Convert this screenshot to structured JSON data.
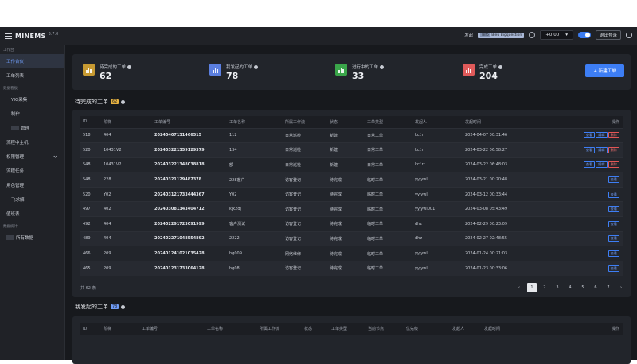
{
  "app": {
    "title": "MINEMS",
    "version": "3.7.0"
  },
  "topbar": {
    "label": "发起",
    "badge_prefix": "Info",
    "badge_text": "Bleu Bigquestion",
    "time_value": "+0:00",
    "time_unit": "▾",
    "logout_label": "退出登录"
  },
  "sidebar": {
    "groups": [
      {
        "label": "工作台",
        "items": [
          {
            "label": "工作台仪",
            "active": true
          },
          {
            "label": "工单列表",
            "active": false
          }
        ]
      },
      {
        "label": "数据看板",
        "items": [
          {
            "label": "YIG采集",
            "sub": true
          },
          {
            "label": "制作",
            "sub": true
          },
          {
            "label": "管理",
            "sub": true,
            "blur": true
          },
          {
            "label": "流程中主机"
          },
          {
            "label": "权限管理",
            "chevron": true
          },
          {
            "label": "流程任务"
          },
          {
            "label": "角色管理"
          },
          {
            "label": "飞求解",
            "sub": true
          },
          {
            "label": "值班表"
          }
        ]
      },
      {
        "label": "数据统计",
        "items": [
          {
            "label": "所有数据",
            "blur": true
          }
        ]
      }
    ]
  },
  "stats": [
    {
      "label": "待完成的工单",
      "value": "62",
      "color": "#c79a32",
      "icon": "chart-bar-icon"
    },
    {
      "label": "我发起的工单",
      "value": "78",
      "color": "#5b7fe0",
      "icon": "chart-bar-icon"
    },
    {
      "label": "进行中的工单",
      "value": "33",
      "color": "#3aa64a",
      "icon": "chart-bar-icon"
    },
    {
      "label": "完成工单",
      "value": "204",
      "color": "#e05a5a",
      "icon": "chart-bar-icon"
    }
  ],
  "new_button": "+ 新建工单",
  "pending": {
    "title": "待完成的工单",
    "count": "62",
    "count_color": "#e8b341",
    "columns": [
      "ID",
      "阶梯",
      "工单编号",
      "工单名称",
      "所属工作流",
      "状态",
      "工单类型",
      "发起人",
      "发起时间",
      "操作"
    ],
    "rows": [
      {
        "id": "518",
        "step": "404",
        "no": "20240407131466515",
        "name": "112",
        "flow": "日常巡检",
        "status": "新建",
        "type": "日常工单",
        "by": "kcf.rr",
        "time": "2024-04-07 00:31:46",
        "ops": [
          "查看",
          "编辑",
          "删除"
        ]
      },
      {
        "id": "520",
        "step": "10431V2",
        "no": "20240322135912937​9",
        "name": "134",
        "flow": "日常巡检",
        "status": "新建",
        "type": "日常工单",
        "by": "kcf.rr",
        "time": "2024-03-22 06:58:27",
        "ops": [
          "查看",
          "编辑",
          "删除"
        ]
      },
      {
        "id": "548",
        "step": "10431V2",
        "no": "20240322134803881​8",
        "name": "额",
        "flow": "日常巡检",
        "status": "新建",
        "type": "日常工单",
        "by": "kcf.rr",
        "time": "2024-03-22 06:48:03",
        "ops": [
          "查看",
          "编辑",
          "删除"
        ]
      },
      {
        "id": "548",
        "step": "228",
        "no": "20240321129487378",
        "name": "228客户",
        "flow": "访客登记",
        "status": "待完成",
        "type": "临时工单",
        "by": "yyjywl",
        "time": "2024-03-21 00:20:48",
        "ops": [
          "查看"
        ]
      },
      {
        "id": "520",
        "step": "Y02",
        "no": "20240312173344436​7",
        "name": "Y02",
        "flow": "访客登记",
        "status": "待完成",
        "type": "临时工单",
        "by": "yyjywl",
        "time": "2024-03-12 00:33:44",
        "ops": [
          "查看"
        ]
      },
      {
        "id": "497",
        "step": "402",
        "no": "20240308134340471​2",
        "name": "kjk2dj",
        "flow": "访客登记",
        "status": "待完成",
        "type": "临时工单",
        "by": "yyjywl001",
        "time": "2024-03-08 05:43:49",
        "ops": [
          "查看"
        ]
      },
      {
        "id": "492",
        "step": "404",
        "no": "20240229172309199​9",
        "name": "客户测试",
        "flow": "访客登记",
        "status": "待完成",
        "type": "临时工单",
        "by": "dhz",
        "time": "2024-02-29 00:23:09",
        "ops": [
          "查看"
        ]
      },
      {
        "id": "489",
        "step": "404",
        "no": "20240227104855489​2",
        "name": "2222",
        "flow": "访客登记",
        "status": "待完成",
        "type": "临时工单",
        "by": "dhz",
        "time": "2024-02-27 02:48:55",
        "ops": [
          "查看"
        ]
      },
      {
        "id": "466",
        "step": "209",
        "no": "20240124102103542​8",
        "name": "hg009",
        "flow": "网络维修",
        "status": "待完成",
        "type": "临时工单",
        "by": "yyjywl",
        "time": "2024-01-24 00:21:03",
        "ops": [
          "查看"
        ]
      },
      {
        "id": "465",
        "step": "209",
        "no": "20240123173306412​8",
        "name": "hg08",
        "flow": "访客登记",
        "status": "待完成",
        "type": "临时工单",
        "by": "yyjywl",
        "time": "2024-01-23 00:33:06",
        "ops": [
          "查看"
        ]
      }
    ],
    "total": "共 62 条",
    "pages": [
      "‹",
      "1",
      "2",
      "3",
      "4",
      "5",
      "6",
      "7",
      "›"
    ]
  },
  "launched": {
    "title": "我发起的工单",
    "count": "78",
    "count_color": "#6f9bf5",
    "columns": [
      "ID",
      "阶梯",
      "工单编号",
      "工单名称",
      "所属工作流",
      "状态",
      "工单类型",
      "当前节点",
      "优先级",
      "发起人",
      "发起时间",
      "操作"
    ]
  },
  "colors": {
    "accent": "#3d7ef5",
    "danger": "#e25555"
  }
}
